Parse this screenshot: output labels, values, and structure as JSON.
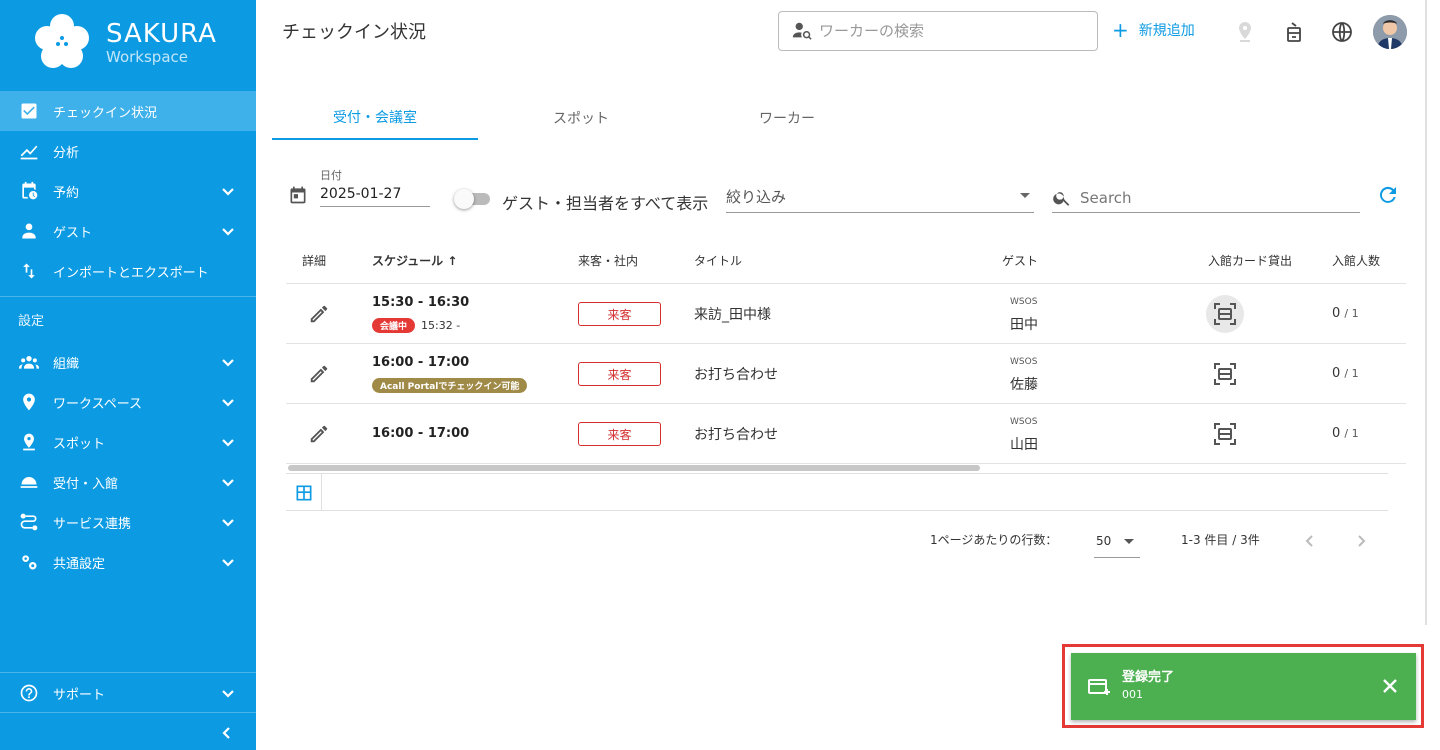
{
  "brand": {
    "name": "SAKURA",
    "sub": "Workspace"
  },
  "sidebar": {
    "items": [
      {
        "label": "チェックイン状況"
      },
      {
        "label": "分析"
      },
      {
        "label": "予約"
      },
      {
        "label": "ゲスト"
      },
      {
        "label": "インポートとエクスポート"
      }
    ],
    "section_label": "設定",
    "settings_items": [
      {
        "label": "組織"
      },
      {
        "label": "ワークスペース"
      },
      {
        "label": "スポット"
      },
      {
        "label": "受付・入館"
      },
      {
        "label": "サービス連携"
      },
      {
        "label": "共通設定"
      }
    ],
    "support_label": "サポート"
  },
  "header": {
    "title": "チェックイン状況",
    "search_placeholder": "ワーカーの検索",
    "add_label": "新規追加",
    "add_plus": "+"
  },
  "tabs": [
    {
      "label": "受付・会議室"
    },
    {
      "label": "スポット"
    },
    {
      "label": "ワーカー"
    }
  ],
  "filters": {
    "date_label": "日付",
    "date_value": "2025-01-27",
    "toggle_label": "ゲスト・担当者をすべて表示",
    "filter_select": "絞り込み",
    "search_placeholder": "Search"
  },
  "table": {
    "headers": {
      "detail": "詳細",
      "schedule": "スケジュール",
      "sort_arrow": "↑",
      "visitor_type": "来客・社内",
      "title": "タイトル",
      "guest": "ゲスト",
      "card": "入館カード貸出",
      "count": "入館人数"
    },
    "rows": [
      {
        "time": "15:30 - 16:30",
        "badge": "会議中",
        "sub_time": "15:32 -",
        "type": "来客",
        "title": "来訪_田中様",
        "company": "WSOS",
        "guest": "田中",
        "count": "0",
        "count_total": "/ 1"
      },
      {
        "time": "16:00 - 17:00",
        "badge": "Acall Portalでチェックイン可能",
        "type": "来客",
        "title": "お打ち合わせ",
        "company": "WSOS",
        "guest": "佐藤",
        "count": "0",
        "count_total": "/ 1"
      },
      {
        "time": "16:00 - 17:00",
        "type": "来客",
        "title": "お打ち合わせ",
        "company": "WSOS",
        "guest": "山田",
        "count": "0",
        "count_total": "/ 1"
      }
    ]
  },
  "pagination": {
    "rows_per_page_label": "1ページあたりの行数：",
    "rows_per_page": "50",
    "range": "1-3 件目 / 3件"
  },
  "toast": {
    "title": "登録完了",
    "detail": "001"
  },
  "colors": {
    "sidebar": "#0c9be3",
    "accent": "#0c9be3",
    "toast": "#4caf50",
    "highlight": "#e53935"
  }
}
